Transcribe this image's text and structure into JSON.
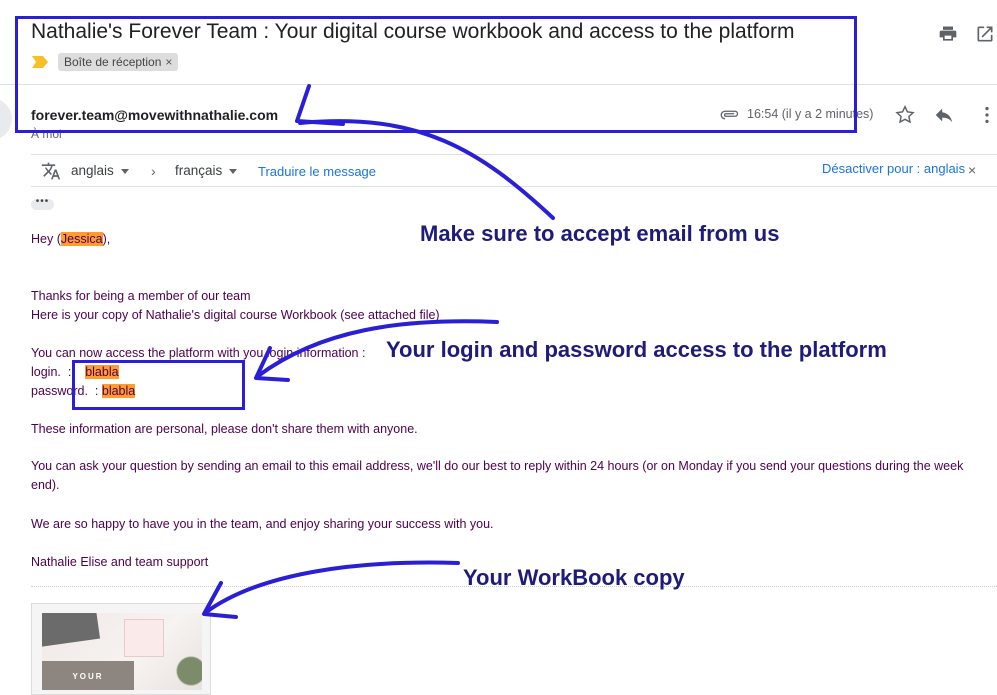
{
  "email": {
    "subject": "Nathalie's Forever Team : Your digital course workbook and access to the platform",
    "label": "Boîte de réception",
    "label_remove": "×",
    "sender": "forever.team@movewithnathalie.com",
    "recipient": "À moi",
    "time": "16:54 (il y a 2 minutes)"
  },
  "translation": {
    "from_lang": "anglais",
    "to_lang": "français",
    "translate_link": "Traduire le message",
    "disable_label": "Désactiver pour : anglais",
    "close": "×",
    "arrow": "›"
  },
  "body": {
    "ellipsis": "•••",
    "greeting_prefix": "Hey (",
    "greeting_name": "Jessica",
    "greeting_suffix": "),",
    "line1": "Thanks for being a member of our team",
    "line2": "Here is your copy of Nathalie's digital course Workbook (see attached file)",
    "line3": "You can now access the platform with you login information :",
    "login_label": "login.  :    ",
    "login_value": "blabla",
    "password_label": "password.  : ",
    "password_value": "blabla",
    "line4": "These information are personal, please don't share them with anyone.",
    "line5": "You can ask your question by sending an email to this email address, we'll do our best to reply within 24 hours (or on Monday if you send your questions during the week end).",
    "line6": "We are so happy to have you in the team, and enjoy sharing your success with you.",
    "signature": "Nathalie Elise and team support"
  },
  "attachment": {
    "thumb_text": "YOUR"
  },
  "annotations": {
    "accept_email": "Make sure to accept email from us",
    "login_access": "Your login and password access to the platform",
    "workbook": "Your WorkBook copy"
  },
  "colors": {
    "annotation_outline": "#2a1fd6",
    "annotation_text": "#1e1b7a",
    "body_text": "#4d004d",
    "highlight": "#ff9c2f",
    "link": "#1a73e8"
  },
  "icons": [
    "print-icon",
    "open-in-new-icon",
    "importance-marker-icon",
    "attachment-icon",
    "star-icon",
    "reply-icon",
    "more-vert-icon",
    "translate-icon"
  ]
}
